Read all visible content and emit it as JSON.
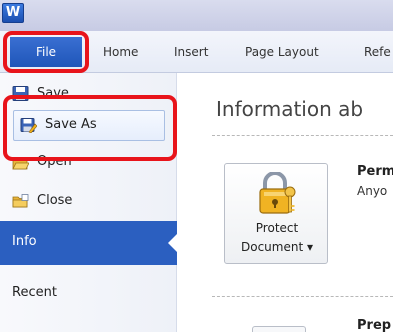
{
  "app": {
    "icon_letter": "W",
    "icon": "word-app-icon"
  },
  "ribbon": {
    "file_label": "File",
    "tabs": [
      "Home",
      "Insert",
      "Page Layout",
      "Refe"
    ]
  },
  "backstage": {
    "save_label": "Save",
    "save_as_label": "Save As",
    "open_label": "Open",
    "close_label": "Close",
    "info_label": "Info",
    "recent_label": "Recent"
  },
  "info_page": {
    "heading": "Information ab",
    "protect_button_line1": "Protect",
    "protect_button_line2": "Document ▾",
    "permissions_title": "Perm",
    "permissions_desc": "Anyo",
    "prepare_title": "Prep"
  },
  "colors": {
    "accent_blue": "#2b5fc0",
    "highlight_red": "#e8141b"
  }
}
